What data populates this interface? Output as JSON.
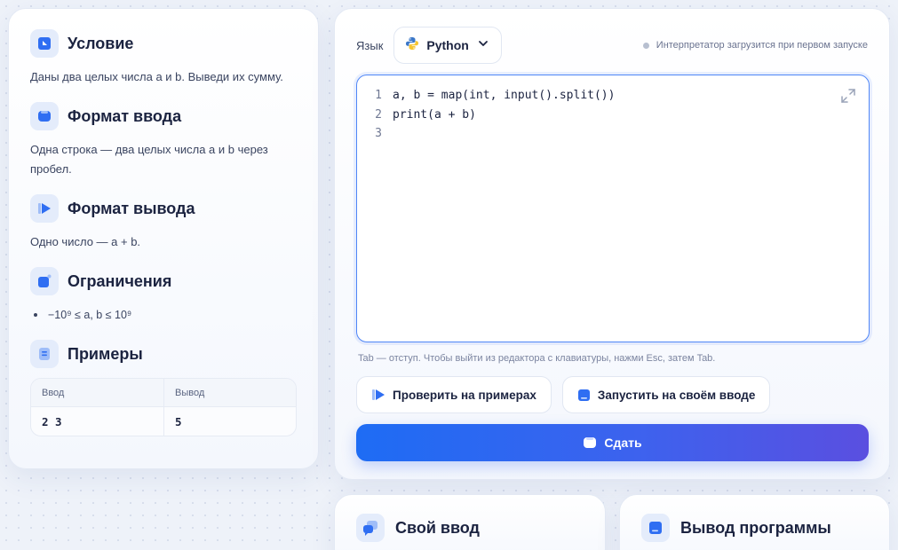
{
  "statement": {
    "condition": {
      "title": "Условие",
      "text": "Даны два целых числа a и b. Выведи их сумму."
    },
    "input_format": {
      "title": "Формат ввода",
      "text": "Одна строка — два целых числа a и b через пробел."
    },
    "output_format": {
      "title": "Формат вывода",
      "text": "Одно число — a + b."
    },
    "constraints": {
      "title": "Ограничения",
      "items": [
        "−10⁹ ≤ a, b ≤ 10⁹"
      ]
    },
    "examples": {
      "title": "Примеры",
      "columns": [
        "Ввод",
        "Вывод"
      ],
      "rows": [
        {
          "input": "2 3",
          "output": "5"
        }
      ]
    }
  },
  "editor": {
    "language_label": "Язык",
    "language": "Python",
    "interpreter_hint": "Интерпретатор загрузится при первом запуске",
    "lines": [
      {
        "num": "1",
        "code": "a, b = map(int, input().split())"
      },
      {
        "num": "2",
        "code": "print(a + b)"
      },
      {
        "num": "3",
        "code": ""
      }
    ],
    "hint": "Tab — отступ. Чтобы выйти из редактора с клавиатуры, нажми Esc, затем Tab.",
    "check_button": "Проверить на примерах",
    "run_button": "Запустить на своём вводе",
    "submit_button": "Сдать"
  },
  "custom_input": {
    "title": "Свой ввод"
  },
  "program_output": {
    "title": "Вывод программы"
  },
  "colors": {
    "accent": "#1e6cf4",
    "accent_end": "#5a4fe0",
    "icon_blue": "#2f6ef2",
    "icon_bg": "#e4ecfb"
  }
}
